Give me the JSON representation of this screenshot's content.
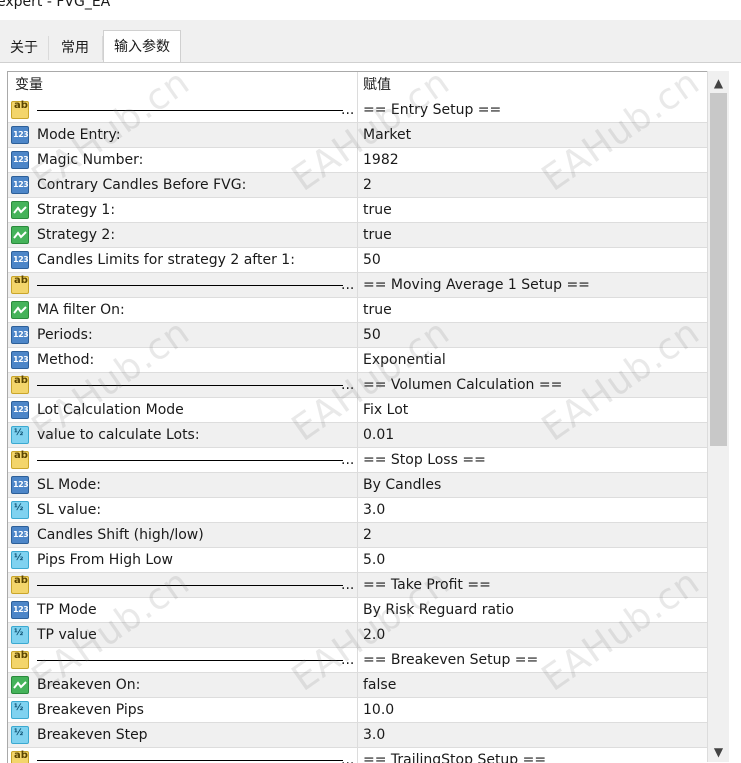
{
  "window": {
    "title": "expert - FVG_EA"
  },
  "tabs": [
    {
      "label": "关于"
    },
    {
      "label": "常用"
    },
    {
      "label": "输入参数"
    }
  ],
  "grid": {
    "columns": {
      "name": "变量",
      "value": "赋值"
    },
    "rows": [
      {
        "type": "ab",
        "name": "——————————————————————",
        "value": "== Entry Setup =="
      },
      {
        "type": "num",
        "name": "Mode Entry:",
        "value": "Market"
      },
      {
        "type": "num",
        "name": "Magic Number:",
        "value": "1982"
      },
      {
        "type": "num",
        "name": "Contrary Candles Before FVG:",
        "value": "2"
      },
      {
        "type": "bool",
        "name": "Strategy 1:",
        "value": "true"
      },
      {
        "type": "bool",
        "name": "Strategy 2:",
        "value": "true"
      },
      {
        "type": "num",
        "name": "Candles Limits for strategy 2 after 1:",
        "value": "50"
      },
      {
        "type": "ab",
        "name": "——————————————————————",
        "value": "== Moving Average 1 Setup =="
      },
      {
        "type": "bool",
        "name": "MA filter On:",
        "value": "true"
      },
      {
        "type": "num",
        "name": "Periods:",
        "value": "50"
      },
      {
        "type": "num",
        "name": "Method:",
        "value": "Exponential"
      },
      {
        "type": "ab",
        "name": "——————————————————————",
        "value": "== Volumen Calculation =="
      },
      {
        "type": "num",
        "name": "Lot Calculation Mode",
        "value": "Fix Lot"
      },
      {
        "type": "frac",
        "name": "value to calculate Lots:",
        "value": "0.01"
      },
      {
        "type": "ab",
        "name": "——————————————————————",
        "value": "== Stop Loss =="
      },
      {
        "type": "num",
        "name": "SL Mode:",
        "value": "By Candles"
      },
      {
        "type": "frac",
        "name": "SL value:",
        "value": "3.0"
      },
      {
        "type": "num",
        "name": "Candles Shift (high/low)",
        "value": "2"
      },
      {
        "type": "frac",
        "name": "Pips From High Low",
        "value": "5.0"
      },
      {
        "type": "ab",
        "name": "——————————————————————",
        "value": "== Take Profit =="
      },
      {
        "type": "num",
        "name": "TP Mode",
        "value": "By Risk Reguard ratio"
      },
      {
        "type": "frac",
        "name": "TP value",
        "value": "2.0"
      },
      {
        "type": "ab",
        "name": "——————————————————————",
        "value": "== Breakeven Setup =="
      },
      {
        "type": "bool",
        "name": "Breakeven On:",
        "value": "false"
      },
      {
        "type": "frac",
        "name": "Breakeven Pips",
        "value": "10.0"
      },
      {
        "type": "frac",
        "name": "Breakeven Step",
        "value": "3.0"
      },
      {
        "type": "ab",
        "name": "——————————————————————",
        "value": "== TrailingStop Setup =="
      }
    ]
  },
  "icons": {
    "ab": {
      "glyph": "ab",
      "name": "string-type-icon"
    },
    "num": {
      "glyph": "123",
      "name": "integer-type-icon"
    },
    "bool": {
      "glyph": "",
      "name": "boolean-type-icon"
    },
    "frac": {
      "glyph": "½",
      "name": "double-type-icon"
    }
  },
  "watermark": {
    "text": "EAHub.cn"
  },
  "scrollbar": {
    "up": "▲",
    "down": "▼"
  }
}
